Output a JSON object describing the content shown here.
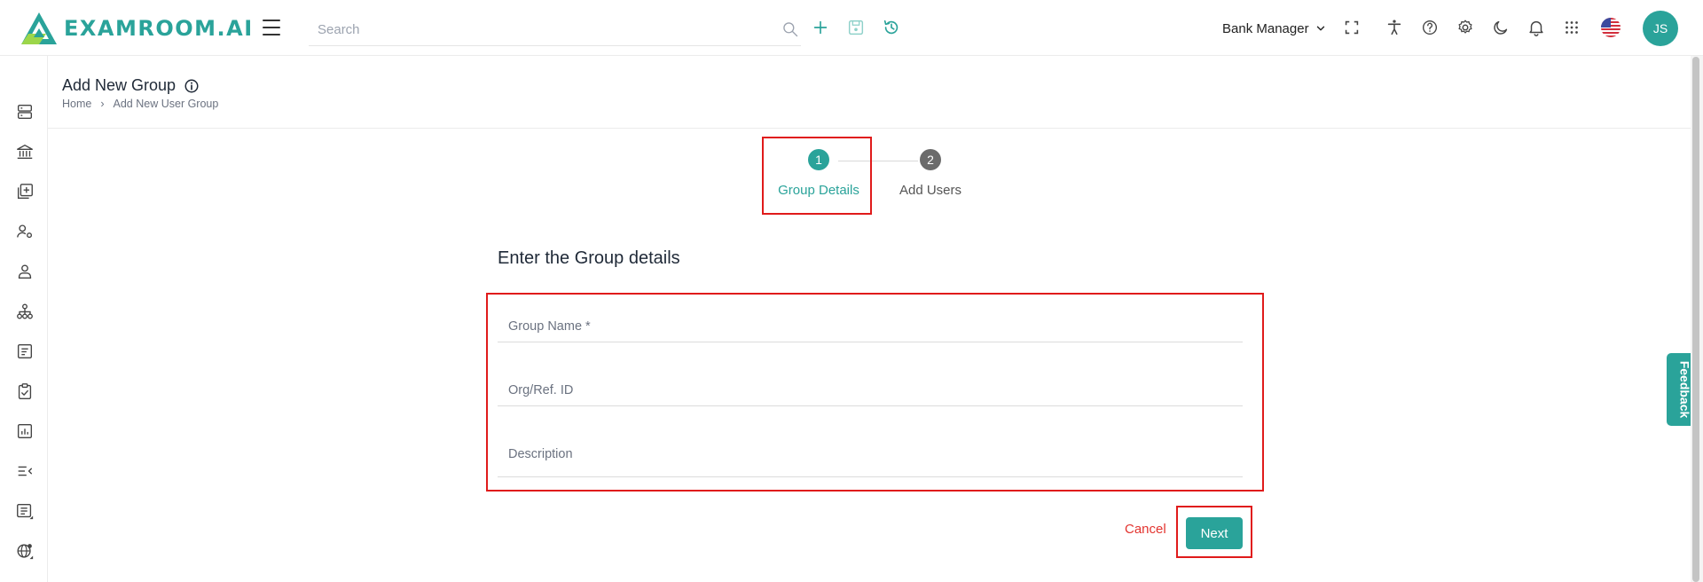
{
  "brand": {
    "name": "EXAMROOM.AI",
    "color": "#2aa39a"
  },
  "search": {
    "placeholder": "Search"
  },
  "header": {
    "role": "Bank Manager",
    "avatar_initials": "JS"
  },
  "page": {
    "title": "Add New Group",
    "breadcrumb": {
      "home": "Home",
      "current": "Add New User Group"
    }
  },
  "stepper": {
    "steps": [
      {
        "number": "1",
        "label": "Group Details",
        "active": true
      },
      {
        "number": "2",
        "label": "Add Users",
        "active": false
      }
    ]
  },
  "form": {
    "title": "Enter the Group details",
    "fields": {
      "group_name": {
        "placeholder": "Group Name *",
        "value": ""
      },
      "org_ref_id": {
        "placeholder": "Org/Ref. ID",
        "value": ""
      },
      "description": {
        "placeholder": "Description",
        "value": ""
      }
    },
    "cancel_label": "Cancel",
    "next_label": "Next"
  },
  "feedback_label": "Feedback",
  "colors": {
    "accent": "#2aa39a",
    "danger": "#e3342f",
    "step_inactive": "#6b6b6b",
    "highlight": "#e01b1b"
  },
  "icons": {
    "topbar": [
      "search-icon",
      "plus-icon",
      "save-icon",
      "history-icon",
      "fullscreen-icon",
      "accessibility-icon",
      "help-icon",
      "settings-icon",
      "dark-mode-icon",
      "notification-bell-icon",
      "apps-grid-icon",
      "us-flag-icon"
    ],
    "sidebar": [
      "server-icon",
      "bank-icon",
      "add-library-icon",
      "user-settings-icon",
      "user-icon",
      "hierarchy-icon",
      "document-icon",
      "clipboard-check-icon",
      "bar-chart-icon",
      "list-collapse-icon",
      "list-report-icon",
      "globe-settings-icon"
    ]
  }
}
